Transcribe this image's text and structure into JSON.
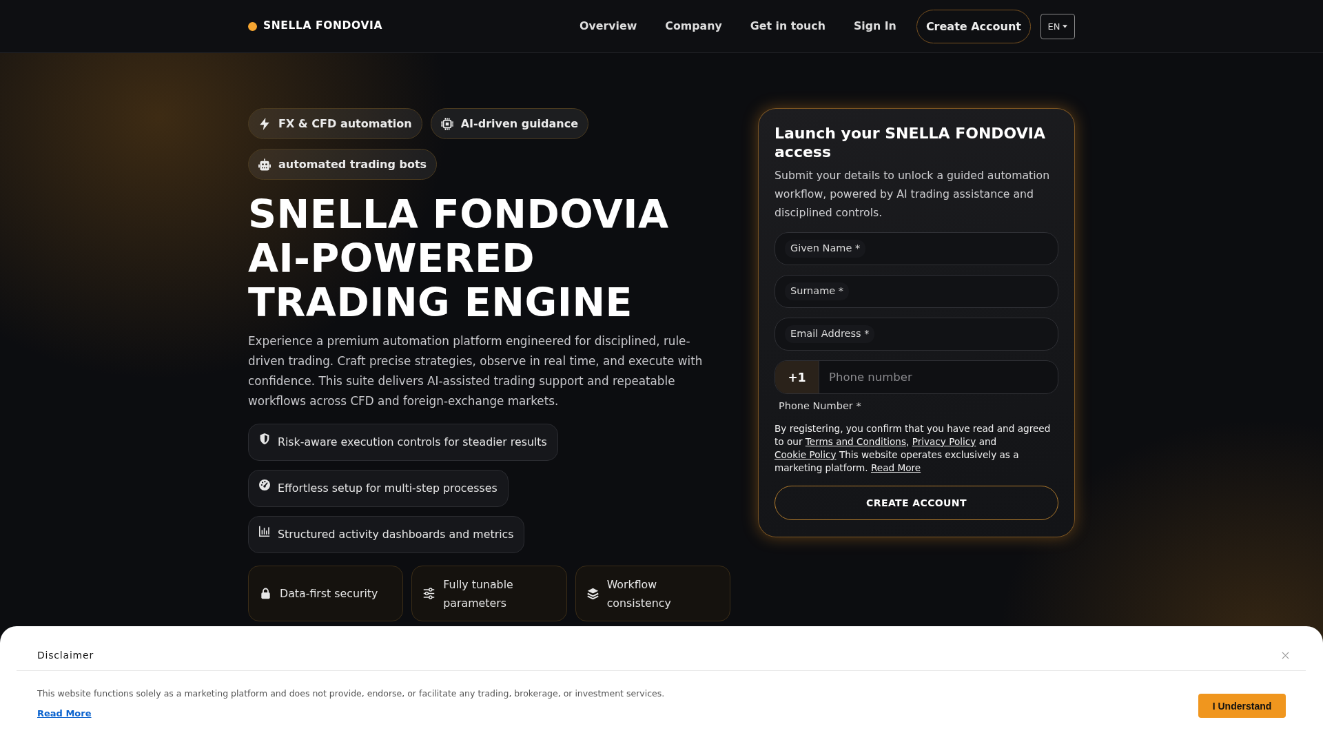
{
  "header": {
    "logo": "SNELLA FONDOVIA",
    "nav": [
      "Overview",
      "Company",
      "Get in touch",
      "Sign In"
    ],
    "cta": "Create Account",
    "language": "EN"
  },
  "hero": {
    "tags": [
      "FX & CFD automation",
      "AI-driven guidance",
      "automated trading bots"
    ],
    "title_lines": [
      "SNELLA FONDOVIA",
      "AI-POWERED",
      "TRADING ENGINE"
    ],
    "description": "Experience a premium automation platform engineered for disciplined, rule-driven trading. Craft precise strategies, observe in real time, and execute with confidence. This suite delivers AI-assisted trading support and repeatable workflows across CFD and foreign-exchange markets.",
    "features": [
      "Risk-aware execution controls for steadier results",
      "Effortless setup for multi-step processes",
      "Structured activity dashboards and metrics"
    ],
    "highlights": [
      "Data-first security",
      "Fully tunable parameters",
      "Workflow consistency"
    ]
  },
  "signup": {
    "title": "Launch your SNELLA FONDOVIA access",
    "description": "Submit your details to unlock a guided automation workflow, powered by AI trading assistance and disciplined controls.",
    "fields": [
      {
        "label": "Given Name *"
      },
      {
        "label": "Surname *"
      },
      {
        "label": "Email Address *"
      }
    ],
    "phone": {
      "country_code": "+1",
      "placeholder": "Phone number",
      "label": "Phone Number *"
    },
    "legal": [
      {
        "kind": "text",
        "text": "By registering, you confirm that you have read and agreed to our "
      },
      {
        "kind": "link",
        "text": "Terms and Conditions"
      },
      {
        "kind": "text",
        "text": ", "
      },
      {
        "kind": "link",
        "text": "Privacy Policy"
      },
      {
        "kind": "text",
        "text": " and "
      },
      {
        "kind": "link",
        "text": "Cookie Policy"
      },
      {
        "kind": "text",
        "text": " This website operates exclusively as a marketing platform. "
      },
      {
        "kind": "link",
        "text": "Read More"
      }
    ],
    "submit": "CREATE ACCOUNT"
  },
  "disclaimer": {
    "title": "Disclaimer",
    "text": "This website functions solely as a marketing platform and does not provide, endorse, or facilitate any trading, brokerage, or investment services.",
    "link": "Read More",
    "button": "I Understand"
  }
}
